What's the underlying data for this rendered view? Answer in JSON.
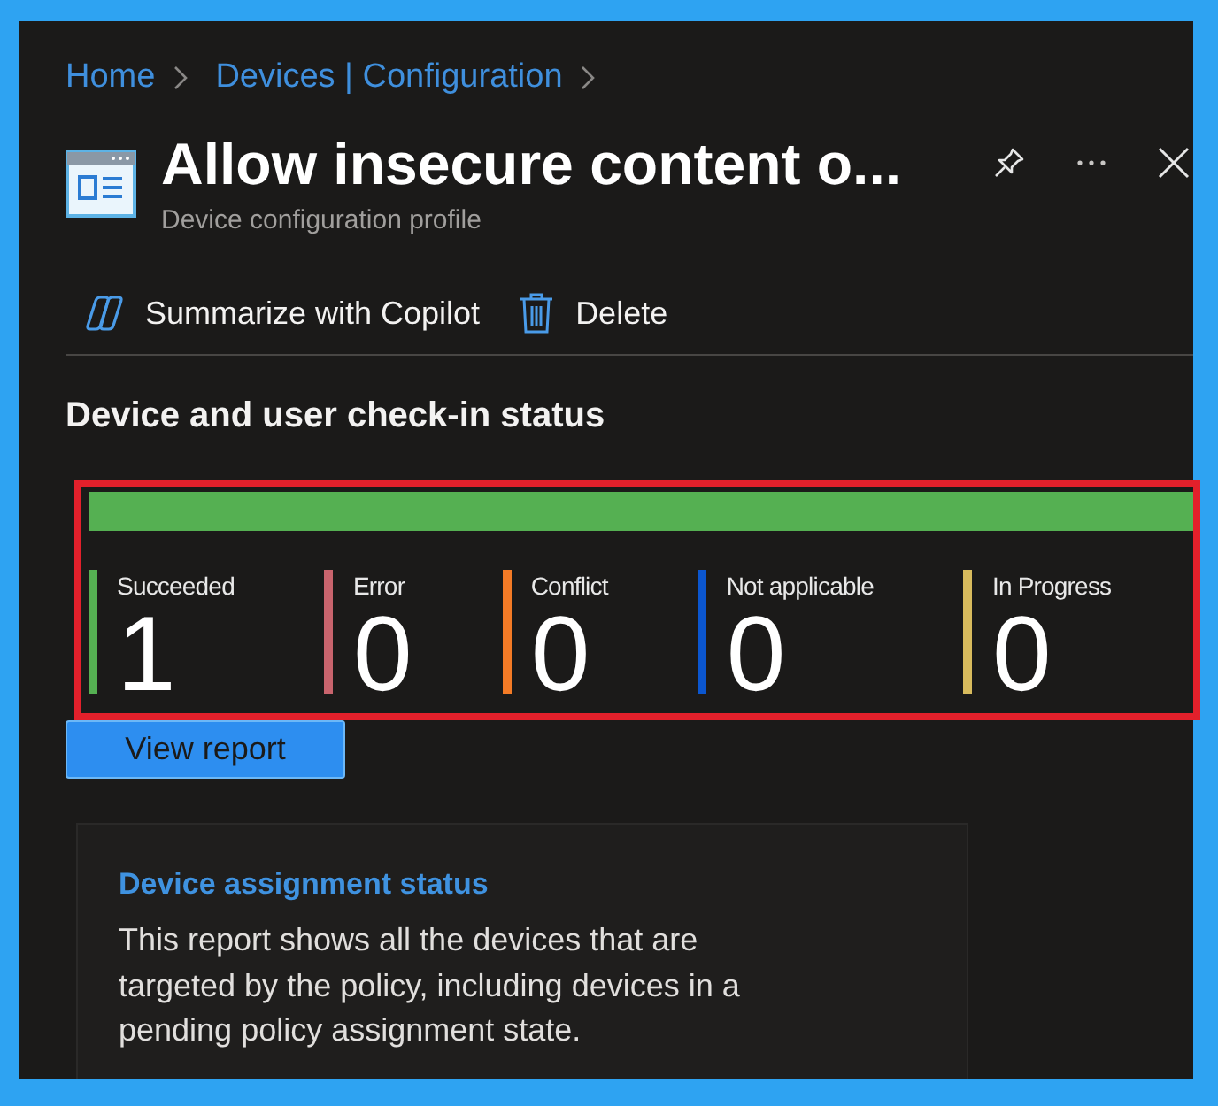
{
  "breadcrumbs": [
    {
      "label": "Home"
    },
    {
      "label": "Devices | Configuration"
    }
  ],
  "header": {
    "title": "Allow insecure content o...",
    "subtitle": "Device configuration profile"
  },
  "toolbar": [
    {
      "kind": "copilot",
      "label": "Summarize with Copilot"
    },
    {
      "kind": "delete",
      "label": "Delete"
    }
  ],
  "checkin_status": {
    "title": "Device and user check-in status",
    "statuses": [
      {
        "label": "Succeeded",
        "count": "1",
        "color": "#55b052"
      },
      {
        "label": "Error",
        "count": "0",
        "color": "#c9646d"
      },
      {
        "label": "Conflict",
        "count": "0",
        "color": "#f47b26"
      },
      {
        "label": "Not applicable",
        "count": "0",
        "color": "#0b56cf"
      },
      {
        "label": "In Progress",
        "count": "0",
        "color": "#d8bb5d"
      }
    ],
    "button": "View report"
  },
  "report_card": {
    "title": "Device assignment status",
    "description": "This report shows all the devices that are targeted by the policy, including devices in a pending policy assignment state."
  }
}
